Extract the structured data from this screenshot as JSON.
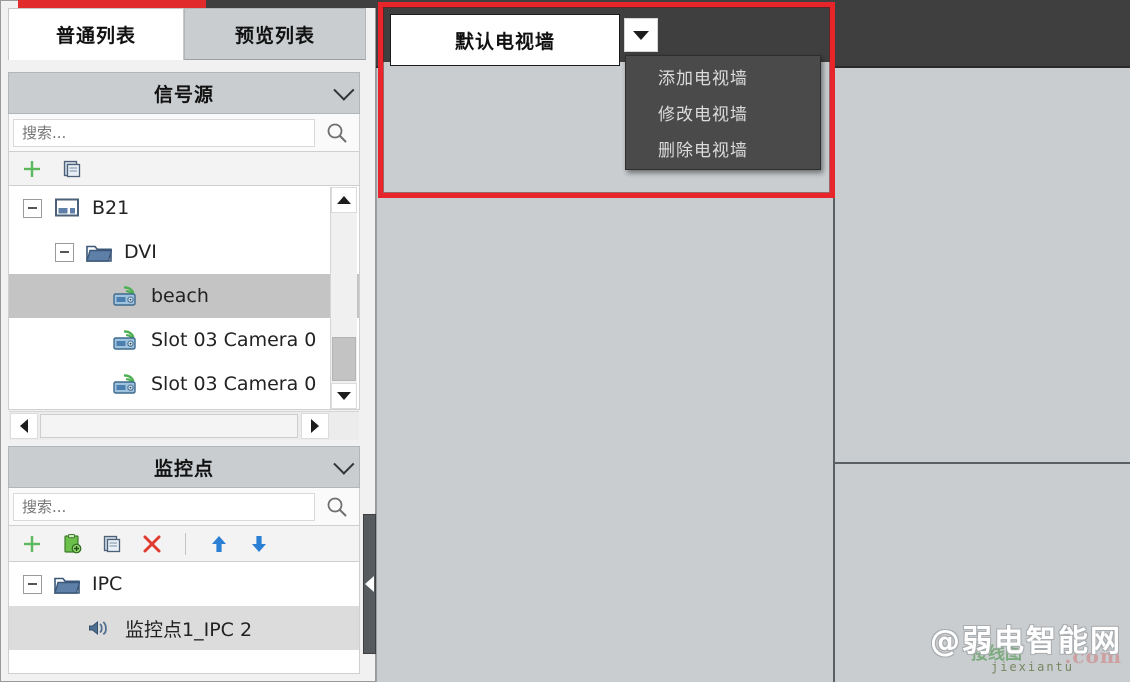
{
  "window": {
    "accent_red": "#e02a2c",
    "toolbar_dark": "#3f3f3f",
    "wall_bg": "#c9cdcf"
  },
  "left_panel": {
    "tabs": [
      {
        "label": "普通列表",
        "active": true
      },
      {
        "label": "预览列表",
        "active": false
      }
    ],
    "signal_source": {
      "title": "信号源",
      "chevron_icon": "chevron-down-icon",
      "search_placeholder": "搜索...",
      "search_value": "",
      "search_icon": "search-icon",
      "toolbar": [
        {
          "name": "add-signal-source-button",
          "icon": "plus-icon"
        },
        {
          "name": "copy-signal-source-button",
          "icon": "copy-icon"
        }
      ],
      "tree": [
        {
          "label": "B21",
          "icon": "monitor-icon",
          "indent": 0,
          "expander": true,
          "selected": false
        },
        {
          "label": "DVI",
          "icon": "folder-icon",
          "indent": 1,
          "expander": true,
          "selected": false
        },
        {
          "label": "beach",
          "icon": "camera-icon",
          "indent": 2,
          "expander": false,
          "selected": true
        },
        {
          "label": "Slot 03 Camera 0",
          "icon": "camera-icon",
          "indent": 2,
          "expander": false,
          "selected": false
        },
        {
          "label": "Slot 03 Camera 0",
          "icon": "camera-icon",
          "indent": 2,
          "expander": false,
          "selected": false
        }
      ]
    },
    "monitor_point": {
      "title": "监控点",
      "chevron_icon": "chevron-down-icon",
      "search_placeholder": "搜索...",
      "search_value": "",
      "search_icon": "search-icon",
      "toolbar": [
        {
          "name": "add-monitor-point-button",
          "icon": "plus-icon"
        },
        {
          "name": "add-from-clipboard-button",
          "icon": "clipboard-add-icon"
        },
        {
          "name": "copy-monitor-point-button",
          "icon": "copy-icon"
        },
        {
          "name": "delete-monitor-point-button",
          "icon": "close-x-icon"
        },
        {
          "name": "move-up-button",
          "icon": "arrow-up-icon"
        },
        {
          "name": "move-down-button",
          "icon": "arrow-down-icon"
        }
      ],
      "tree": [
        {
          "label": "IPC",
          "icon": "folder-icon",
          "indent": 0,
          "expander": true,
          "selected": false
        },
        {
          "label": "监控点1_IPC 2",
          "icon": "audio-icon",
          "indent": 1,
          "expander": false,
          "selected": true
        }
      ]
    },
    "splitter_icon": "collapse-left-icon"
  },
  "wall_toolbar": {
    "selected_wall": "默认电视墙",
    "dropdown_icon": "chevron-down-icon",
    "menu_items": [
      {
        "label": "添加电视墙"
      },
      {
        "label": "修改电视墙"
      },
      {
        "label": "删除电视墙"
      }
    ]
  },
  "watermark": {
    "primary": "@弱电智能网",
    "secondary": "jiexiantu",
    "tertiary": ".com",
    "quaternary": "接线图"
  }
}
